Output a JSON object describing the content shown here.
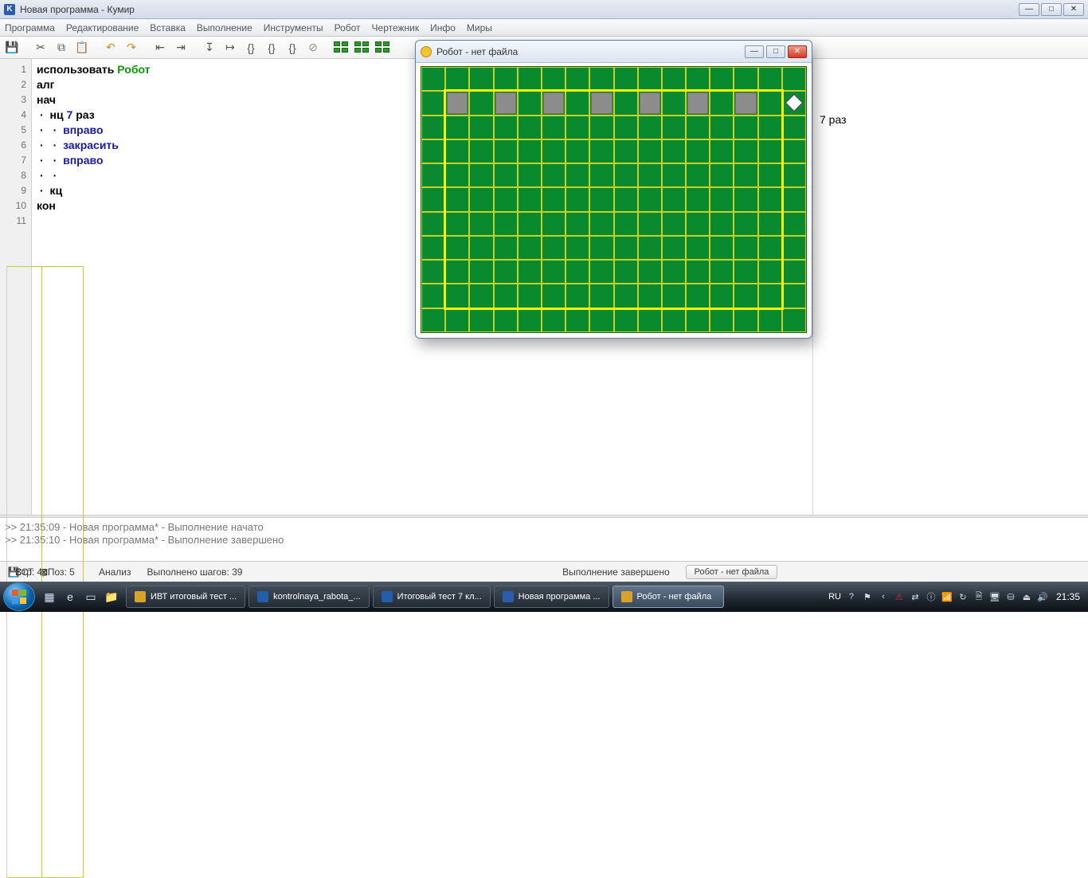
{
  "window": {
    "title": "Новая программа - Кумир"
  },
  "menu": {
    "items": [
      "Программа",
      "Редактирование",
      "Вставка",
      "Выполнение",
      "Инструменты",
      "Робот",
      "Чертежник",
      "Инфо",
      "Миры"
    ]
  },
  "code": {
    "lines": [
      {
        "n": "1",
        "tokens": [
          {
            "t": "использовать ",
            "c": "kw"
          },
          {
            "t": "Робот",
            "c": "green"
          }
        ]
      },
      {
        "n": "2",
        "tokens": [
          {
            "t": "алг",
            "c": "kw"
          }
        ]
      },
      {
        "n": "3",
        "tokens": [
          {
            "t": "нач",
            "c": "kw"
          }
        ]
      },
      {
        "n": "4",
        "tokens": [
          {
            "t": "·",
            "c": "bullet"
          },
          {
            "t": " нц ",
            "c": "kw"
          },
          {
            "t": "7",
            "c": "kw2"
          },
          {
            "t": " раз",
            "c": "kw"
          }
        ]
      },
      {
        "n": "5",
        "tokens": [
          {
            "t": "·",
            "c": "bullet"
          },
          {
            "t": " ",
            "c": ""
          },
          {
            "t": "·",
            "c": "bullet"
          },
          {
            "t": " вправо",
            "c": "kw2"
          }
        ]
      },
      {
        "n": "6",
        "tokens": [
          {
            "t": "·",
            "c": "bullet"
          },
          {
            "t": " ",
            "c": ""
          },
          {
            "t": "·",
            "c": "bullet"
          },
          {
            "t": " закрасить",
            "c": "kw2"
          }
        ]
      },
      {
        "n": "7",
        "tokens": [
          {
            "t": "·",
            "c": "bullet"
          },
          {
            "t": " ",
            "c": ""
          },
          {
            "t": "·",
            "c": "bullet"
          },
          {
            "t": " вправо",
            "c": "kw2"
          }
        ]
      },
      {
        "n": "8",
        "tokens": [
          {
            "t": "·",
            "c": "bullet"
          },
          {
            "t": " ",
            "c": ""
          },
          {
            "t": "·",
            "c": "bullet"
          }
        ]
      },
      {
        "n": "9",
        "tokens": [
          {
            "t": "·",
            "c": "bullet"
          },
          {
            "t": " кц",
            "c": "kw"
          }
        ]
      },
      {
        "n": "10",
        "tokens": [
          {
            "t": "кон",
            "c": "kw"
          }
        ]
      },
      {
        "n": "11",
        "tokens": []
      }
    ]
  },
  "right_pane": {
    "visible_text": "7  раз"
  },
  "console": {
    "line1": ">> 21:35:09 - Новая программа* - Выполнение начато",
    "line2": ">> 21:35:10 - Новая программа* - Выполнение завершено"
  },
  "status": {
    "analysis": "Анализ",
    "steps": "Выполнено шагов: 39",
    "exec_done": "Выполнение завершено",
    "robot_btn": "Робот - нет файла",
    "cursor": "Стр: 4, Поз: 5",
    "mode": "ВСТ"
  },
  "robot": {
    "title": "Робот - нет файла",
    "cols": 16,
    "rows": 11,
    "painted_cells": [
      [
        1,
        1
      ],
      [
        1,
        3
      ],
      [
        1,
        5
      ],
      [
        1,
        7
      ],
      [
        1,
        9
      ],
      [
        1,
        11
      ],
      [
        1,
        13
      ]
    ],
    "robot_at": [
      1,
      15
    ]
  },
  "taskbar": {
    "items": [
      {
        "label": "ИВТ итоговый тест ...",
        "icon": "y"
      },
      {
        "label": "kontrolnaya_rabota_...",
        "icon": "w"
      },
      {
        "label": "Итоговый тест 7 кл...",
        "icon": "w"
      },
      {
        "label": "Новая программа ...",
        "icon": "k"
      },
      {
        "label": "Робот - нет файла",
        "icon": "y",
        "active": true
      }
    ],
    "lang": "RU",
    "clock": "21:35"
  }
}
